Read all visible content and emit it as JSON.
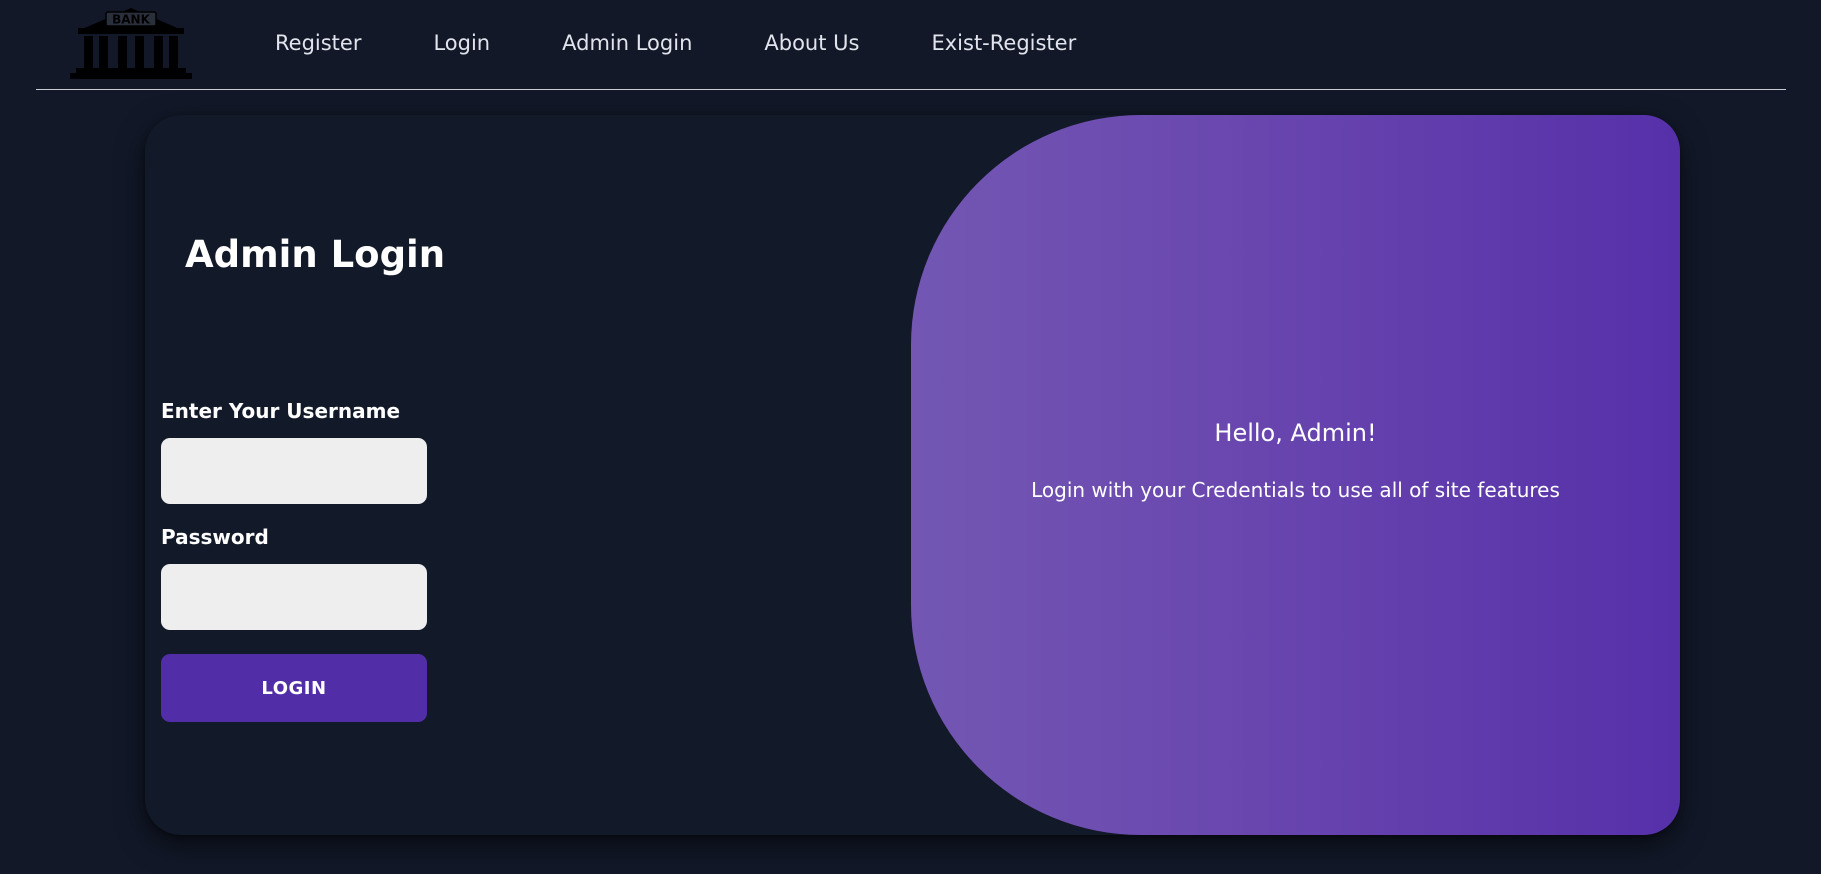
{
  "header": {
    "logo_text": "BANK",
    "nav": [
      {
        "label": "Register"
      },
      {
        "label": "Login"
      },
      {
        "label": "Admin Login"
      },
      {
        "label": "About Us"
      },
      {
        "label": "Exist-Register"
      }
    ]
  },
  "form": {
    "title": "Admin Login",
    "username_label": "Enter Your Username",
    "username_value": "",
    "password_label": "Password",
    "password_value": "",
    "submit_label": "LOGIN"
  },
  "panel": {
    "greeting": "Hello, Admin!",
    "message": "Login with your Credentials to use all of site features"
  },
  "colors": {
    "background": "#121828",
    "accent": "#512da8",
    "panel_gradient_start": "#7357b3",
    "panel_gradient_end": "#5630a9",
    "input_background": "#eeeeee"
  }
}
